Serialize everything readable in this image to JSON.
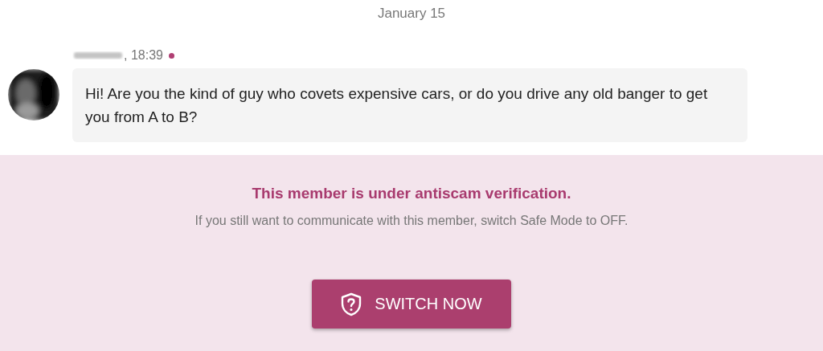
{
  "date_divider": "January 15",
  "message": {
    "time": ", 18:39",
    "online": true,
    "text": "Hi! Are you the kind of guy who covets expensive cars, or do you drive any old banger to get you from A to B?"
  },
  "notice": {
    "title": "This member is under antiscam verification.",
    "text": "If you still want to communicate with this member, switch Safe Mode to OFF.",
    "button": "SWITCH NOW"
  }
}
